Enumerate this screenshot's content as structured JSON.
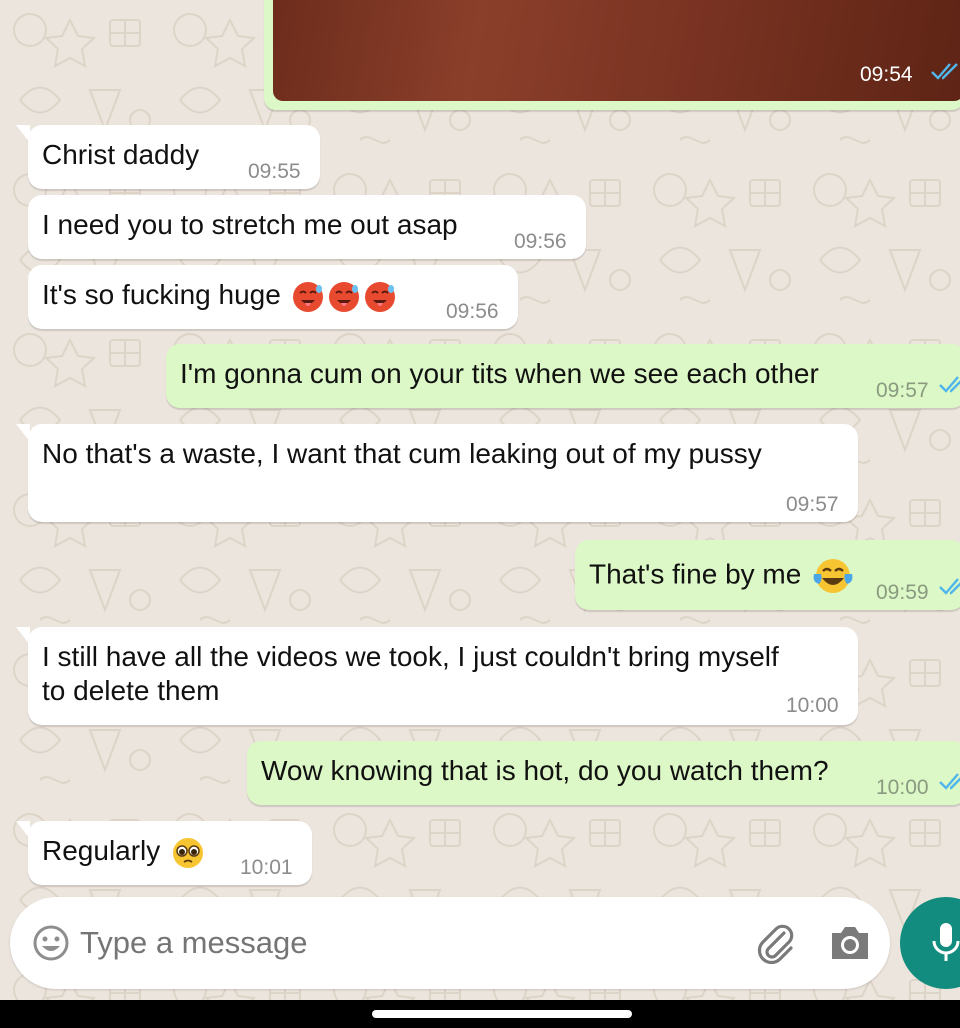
{
  "messages": [
    {
      "id": "m0",
      "direction": "out",
      "kind": "image",
      "text": "",
      "time": "09:54",
      "status": "read"
    },
    {
      "id": "m1",
      "direction": "in",
      "text": "Christ daddy",
      "time": "09:55"
    },
    {
      "id": "m2",
      "direction": "in",
      "text": "I need you to stretch me out asap",
      "time": "09:56"
    },
    {
      "id": "m3",
      "direction": "in",
      "text": "It's so fucking huge",
      "emojis": [
        "hot-face",
        "hot-face",
        "hot-face"
      ],
      "time": "09:56"
    },
    {
      "id": "m4",
      "direction": "out",
      "text": "I'm gonna cum on your tits when we see each other",
      "time": "09:57",
      "status": "read"
    },
    {
      "id": "m5",
      "direction": "in",
      "text": "No that's a waste, I want that cum leaking out of my pussy",
      "time": "09:57"
    },
    {
      "id": "m6",
      "direction": "out",
      "text": "That's fine by me",
      "emojis": [
        "face-with-tears-of-joy"
      ],
      "time": "09:59",
      "status": "read"
    },
    {
      "id": "m7",
      "direction": "in",
      "lines": [
        "I still have all the videos we took, I just couldn't bring myself",
        "to delete them"
      ],
      "time": "10:00"
    },
    {
      "id": "m8",
      "direction": "out",
      "text": "Wow knowing that is hot, do you watch them?",
      "time": "10:00",
      "status": "read"
    },
    {
      "id": "m9",
      "direction": "in",
      "text": "Regularly",
      "emojis": [
        "pleading-face"
      ],
      "time": "10:01"
    }
  ],
  "composer": {
    "placeholder": "Type a message",
    "emoji_icon": "smiley-icon",
    "attach_icon": "paperclip-icon",
    "camera_icon": "camera-icon",
    "mic_icon": "microphone-icon"
  },
  "colors": {
    "wallpaper": "#ece5dd",
    "incoming_bubble": "#ffffff",
    "outgoing_bubble": "#dcf8c6",
    "read_ticks": "#4fb6ec",
    "mic_button": "#128c7e"
  }
}
